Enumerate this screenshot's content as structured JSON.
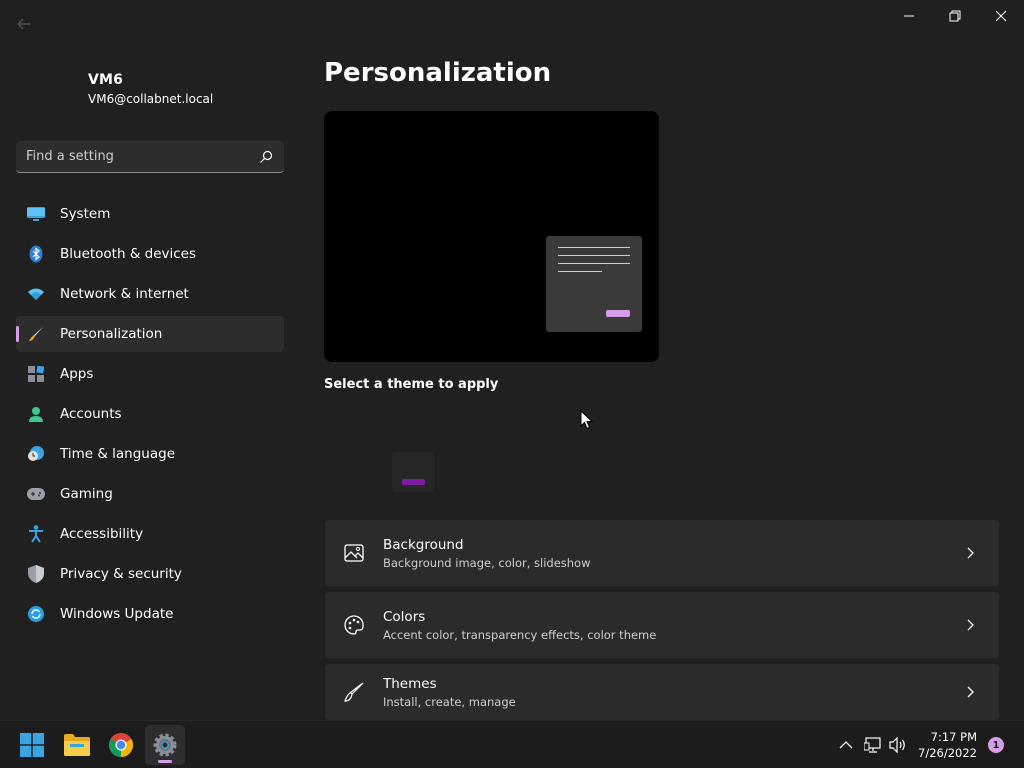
{
  "user": {
    "name": "VM6",
    "email": "VM6@collabnet.local"
  },
  "search": {
    "placeholder": "Find a setting"
  },
  "nav": {
    "items": [
      {
        "label": "System"
      },
      {
        "label": "Bluetooth & devices"
      },
      {
        "label": "Network & internet"
      },
      {
        "label": "Personalization"
      },
      {
        "label": "Apps"
      },
      {
        "label": "Accounts"
      },
      {
        "label": "Time & language"
      },
      {
        "label": "Gaming"
      },
      {
        "label": "Accessibility"
      },
      {
        "label": "Privacy & security"
      },
      {
        "label": "Windows Update"
      }
    ],
    "active_index": 3
  },
  "main": {
    "title": "Personalization",
    "theme_label": "Select a theme to apply",
    "cards": [
      {
        "title": "Background",
        "subtitle": "Background image, color, slideshow",
        "icon": "image-icon"
      },
      {
        "title": "Colors",
        "subtitle": "Accent color, transparency effects, color theme",
        "icon": "palette-icon"
      },
      {
        "title": "Themes",
        "subtitle": "Install, create, manage",
        "icon": "brush-icon"
      }
    ]
  },
  "taskbar": {
    "time": "7:17 PM",
    "date": "7/26/2022",
    "notification_count": "1"
  },
  "colors": {
    "accent": "#d79de8",
    "background": "#202020",
    "card": "#2b2b2b",
    "theme_accent": "#7d1aa0"
  }
}
